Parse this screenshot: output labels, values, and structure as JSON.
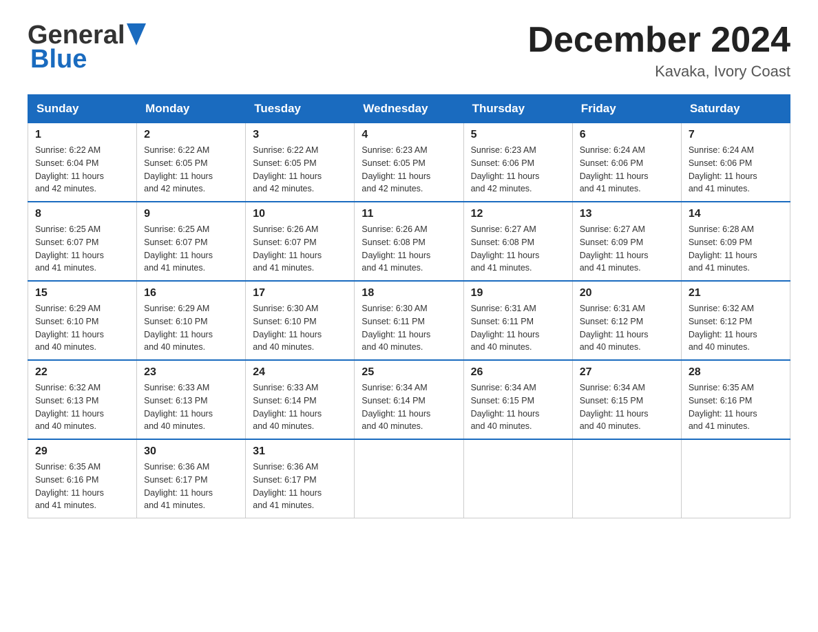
{
  "header": {
    "logo_general": "General",
    "logo_blue": "Blue",
    "month_title": "December 2024",
    "location": "Kavaka, Ivory Coast"
  },
  "weekdays": [
    "Sunday",
    "Monday",
    "Tuesday",
    "Wednesday",
    "Thursday",
    "Friday",
    "Saturday"
  ],
  "weeks": [
    [
      {
        "day": "1",
        "sunrise": "6:22 AM",
        "sunset": "6:04 PM",
        "daylight": "11 hours and 42 minutes."
      },
      {
        "day": "2",
        "sunrise": "6:22 AM",
        "sunset": "6:05 PM",
        "daylight": "11 hours and 42 minutes."
      },
      {
        "day": "3",
        "sunrise": "6:22 AM",
        "sunset": "6:05 PM",
        "daylight": "11 hours and 42 minutes."
      },
      {
        "day": "4",
        "sunrise": "6:23 AM",
        "sunset": "6:05 PM",
        "daylight": "11 hours and 42 minutes."
      },
      {
        "day": "5",
        "sunrise": "6:23 AM",
        "sunset": "6:06 PM",
        "daylight": "11 hours and 42 minutes."
      },
      {
        "day": "6",
        "sunrise": "6:24 AM",
        "sunset": "6:06 PM",
        "daylight": "11 hours and 41 minutes."
      },
      {
        "day": "7",
        "sunrise": "6:24 AM",
        "sunset": "6:06 PM",
        "daylight": "11 hours and 41 minutes."
      }
    ],
    [
      {
        "day": "8",
        "sunrise": "6:25 AM",
        "sunset": "6:07 PM",
        "daylight": "11 hours and 41 minutes."
      },
      {
        "day": "9",
        "sunrise": "6:25 AM",
        "sunset": "6:07 PM",
        "daylight": "11 hours and 41 minutes."
      },
      {
        "day": "10",
        "sunrise": "6:26 AM",
        "sunset": "6:07 PM",
        "daylight": "11 hours and 41 minutes."
      },
      {
        "day": "11",
        "sunrise": "6:26 AM",
        "sunset": "6:08 PM",
        "daylight": "11 hours and 41 minutes."
      },
      {
        "day": "12",
        "sunrise": "6:27 AM",
        "sunset": "6:08 PM",
        "daylight": "11 hours and 41 minutes."
      },
      {
        "day": "13",
        "sunrise": "6:27 AM",
        "sunset": "6:09 PM",
        "daylight": "11 hours and 41 minutes."
      },
      {
        "day": "14",
        "sunrise": "6:28 AM",
        "sunset": "6:09 PM",
        "daylight": "11 hours and 41 minutes."
      }
    ],
    [
      {
        "day": "15",
        "sunrise": "6:29 AM",
        "sunset": "6:10 PM",
        "daylight": "11 hours and 40 minutes."
      },
      {
        "day": "16",
        "sunrise": "6:29 AM",
        "sunset": "6:10 PM",
        "daylight": "11 hours and 40 minutes."
      },
      {
        "day": "17",
        "sunrise": "6:30 AM",
        "sunset": "6:10 PM",
        "daylight": "11 hours and 40 minutes."
      },
      {
        "day": "18",
        "sunrise": "6:30 AM",
        "sunset": "6:11 PM",
        "daylight": "11 hours and 40 minutes."
      },
      {
        "day": "19",
        "sunrise": "6:31 AM",
        "sunset": "6:11 PM",
        "daylight": "11 hours and 40 minutes."
      },
      {
        "day": "20",
        "sunrise": "6:31 AM",
        "sunset": "6:12 PM",
        "daylight": "11 hours and 40 minutes."
      },
      {
        "day": "21",
        "sunrise": "6:32 AM",
        "sunset": "6:12 PM",
        "daylight": "11 hours and 40 minutes."
      }
    ],
    [
      {
        "day": "22",
        "sunrise": "6:32 AM",
        "sunset": "6:13 PM",
        "daylight": "11 hours and 40 minutes."
      },
      {
        "day": "23",
        "sunrise": "6:33 AM",
        "sunset": "6:13 PM",
        "daylight": "11 hours and 40 minutes."
      },
      {
        "day": "24",
        "sunrise": "6:33 AM",
        "sunset": "6:14 PM",
        "daylight": "11 hours and 40 minutes."
      },
      {
        "day": "25",
        "sunrise": "6:34 AM",
        "sunset": "6:14 PM",
        "daylight": "11 hours and 40 minutes."
      },
      {
        "day": "26",
        "sunrise": "6:34 AM",
        "sunset": "6:15 PM",
        "daylight": "11 hours and 40 minutes."
      },
      {
        "day": "27",
        "sunrise": "6:34 AM",
        "sunset": "6:15 PM",
        "daylight": "11 hours and 40 minutes."
      },
      {
        "day": "28",
        "sunrise": "6:35 AM",
        "sunset": "6:16 PM",
        "daylight": "11 hours and 41 minutes."
      }
    ],
    [
      {
        "day": "29",
        "sunrise": "6:35 AM",
        "sunset": "6:16 PM",
        "daylight": "11 hours and 41 minutes."
      },
      {
        "day": "30",
        "sunrise": "6:36 AM",
        "sunset": "6:17 PM",
        "daylight": "11 hours and 41 minutes."
      },
      {
        "day": "31",
        "sunrise": "6:36 AM",
        "sunset": "6:17 PM",
        "daylight": "11 hours and 41 minutes."
      },
      null,
      null,
      null,
      null
    ]
  ],
  "labels": {
    "sunrise": "Sunrise:",
    "sunset": "Sunset:",
    "daylight": "Daylight:"
  }
}
